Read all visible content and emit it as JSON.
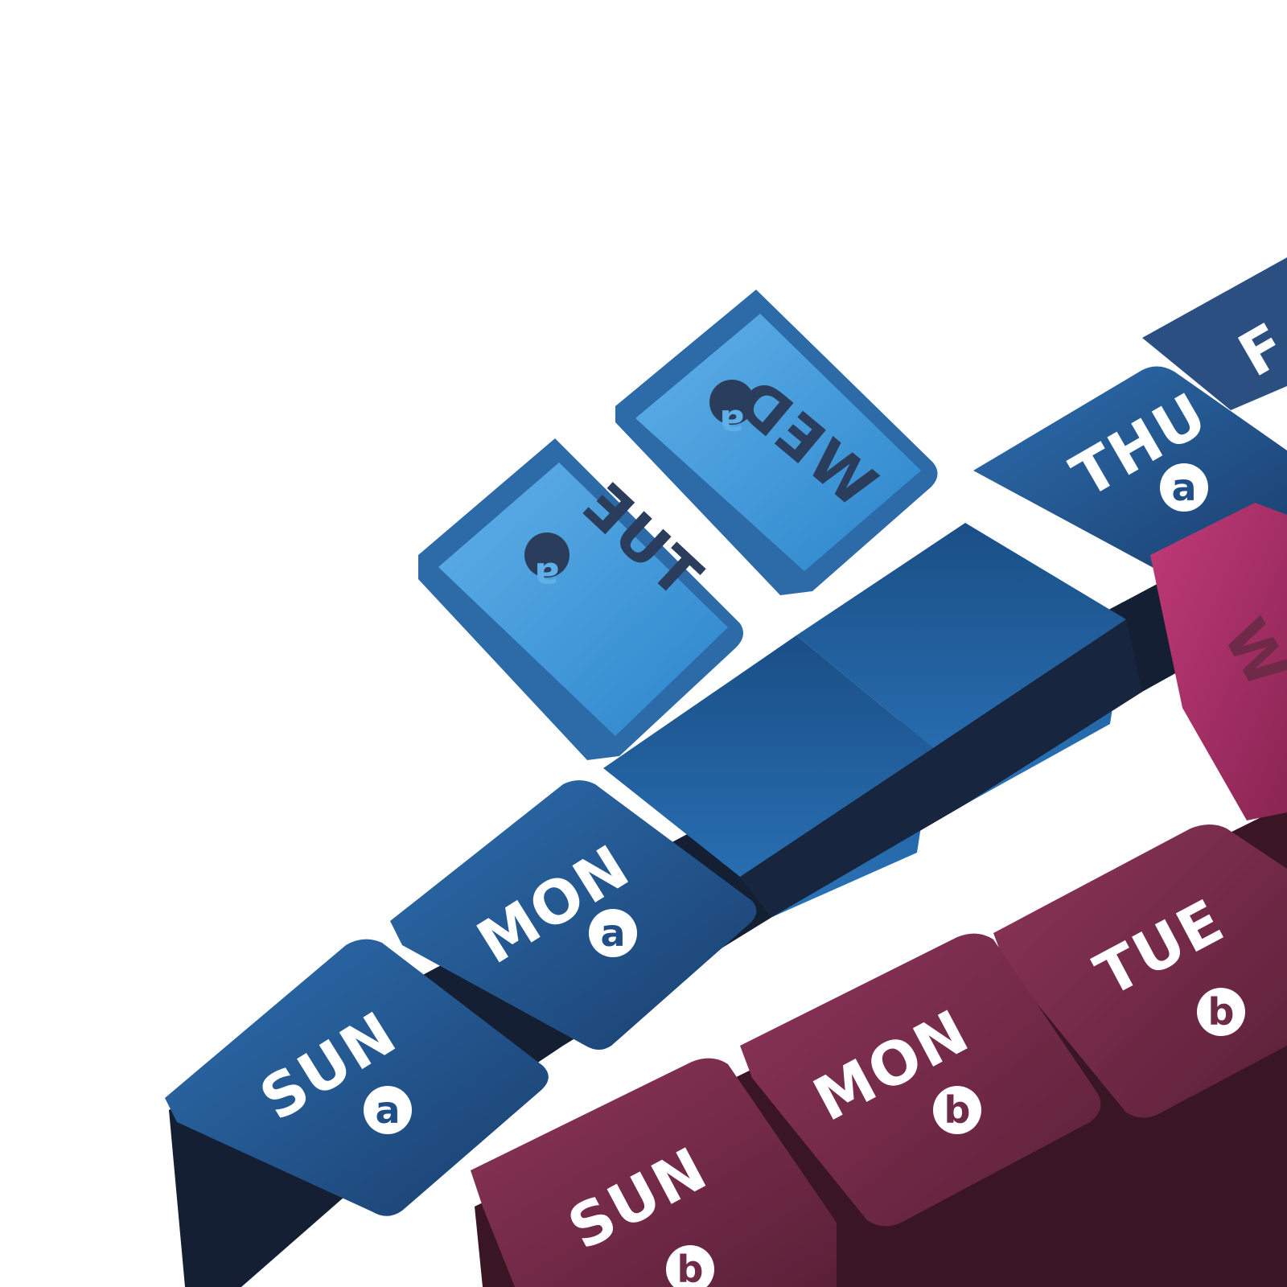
{
  "scene": {
    "subject": "seven-day AM/PM pill organizer strips",
    "colors": {
      "background": "#ffffff",
      "blue_lid": "#1f4f86",
      "blue_lid_light": "#3f8fd2",
      "blue_body": "#15273f",
      "blue_inside": "#1d5f9c",
      "plum_lid": "#6e2a47",
      "plum_lid_light": "#8c3458",
      "plum_body": "#3a1625",
      "plum_open_lid": "#b4326e",
      "label_white": "#ffffff",
      "label_mirrored": "#2b3d5c"
    }
  },
  "blue_strip": {
    "closed": [
      {
        "day": "SUN",
        "slot": "a"
      },
      {
        "day": "MON",
        "slot": "a"
      },
      {
        "day": "THU",
        "slot": "a"
      }
    ],
    "open_lids_mirrored": [
      {
        "day": "TUE",
        "slot": "a"
      },
      {
        "day": "WED",
        "slot": "a"
      }
    ],
    "partial_lid": {
      "day": "F"
    }
  },
  "plum_strip": {
    "closed": [
      {
        "day": "SUN",
        "slot": "b"
      },
      {
        "day": "MON",
        "slot": "b"
      },
      {
        "day": "TUE",
        "slot": "b"
      }
    ],
    "open_lid_partial": {
      "day": "W"
    }
  }
}
